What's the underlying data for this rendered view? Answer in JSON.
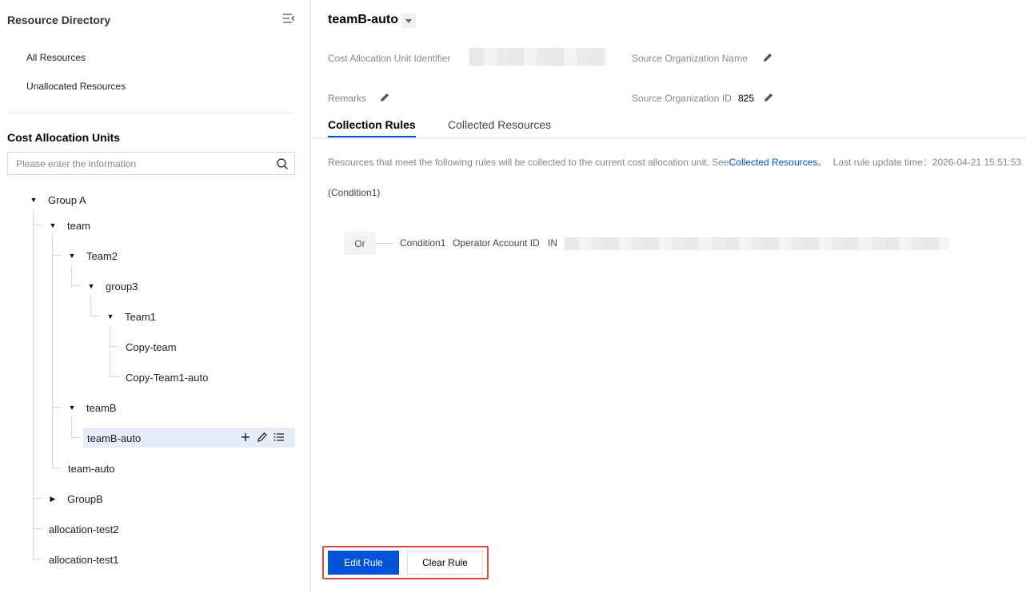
{
  "sidebar": {
    "header": "Resource Directory",
    "links": [
      "All Resources",
      "Unallocated Resources"
    ],
    "cau_title": "Cost Allocation Units",
    "search_placeholder": "Please enter the information",
    "tree": {
      "group_a": "Group A",
      "team": "team",
      "team2": "Team2",
      "group3": "group3",
      "team1": "Team1",
      "copy_team": "Copy-team",
      "copy_team1_auto": "Copy-Team1-auto",
      "teamb": "teamB",
      "teamb_auto": "teamB-auto",
      "team_auto": "team-auto",
      "groupb": "GroupB",
      "alloc_test2": "allocation-test2",
      "alloc_test1": "allocation-test1"
    }
  },
  "main": {
    "title": "teamB-auto",
    "fields": {
      "cau_identifier_label": "Cost Allocation Unit Identifier",
      "source_org_name_label": "Source Organization Name",
      "remarks_label": "Remarks",
      "source_org_id_label": "Source Organization ID",
      "source_org_id_value": "825"
    },
    "tabs": [
      "Collection Rules",
      "Collected Resources"
    ],
    "description": {
      "prefix": "Resources that meet the following rules will be collected to the current cost allocation unit. See",
      "link": "Collected Resources",
      "suffix": "。",
      "update_label": "Last rule update time：",
      "update_time": "2026-04-21 15:51:53"
    },
    "condition_label": "(Condition1)",
    "rule": {
      "logic": "Or",
      "condition": "Condition1",
      "field": "Operator Account ID",
      "operator": "IN"
    },
    "buttons": {
      "edit": "Edit Rule",
      "clear": "Clear Rule"
    }
  },
  "colors": {
    "primary": "#0052d9",
    "highlight_outline": "#e54545",
    "selected_bg": "#e5edfb"
  }
}
